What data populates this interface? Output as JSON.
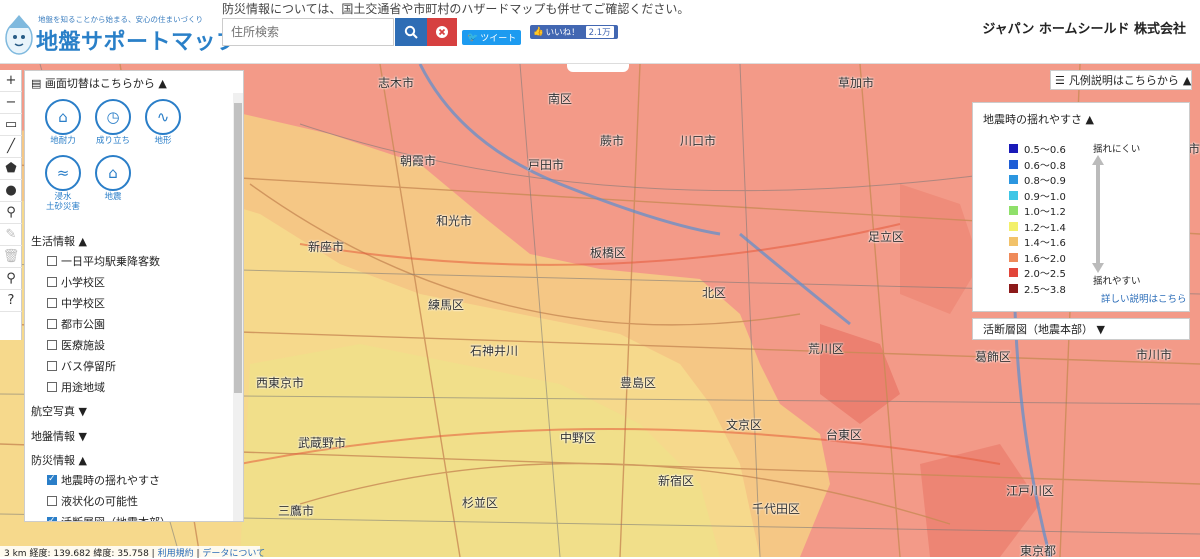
{
  "header": {
    "tagline": "地盤を知ることから始まる、安心の住まいづくり",
    "title": "地盤サポートマップ",
    "notice": "防災情報については、国土交通省や市町村のハザードマップも併せてご確認ください。",
    "search_placeholder": "住所検索",
    "tweet_label": "ツイート",
    "like_label": "いいね！",
    "like_count": "2.1万",
    "company": "ジャパン ホームシールド 株式会社"
  },
  "panel": {
    "title": "画面切替はこちらから",
    "theme_icons": [
      {
        "label": "地耐力",
        "icon": "house-ground-icon"
      },
      {
        "label": "成り立ち",
        "icon": "clock-history-icon"
      },
      {
        "label": "地形",
        "icon": "terrain-icon"
      },
      {
        "label": "浸水\n土砂災害",
        "icon": "flood-icon"
      },
      {
        "label": "地震",
        "icon": "earthquake-icon"
      }
    ],
    "life_section": "生活情報",
    "life_items": [
      "一日平均駅乗降客数",
      "小学校区",
      "中学校区",
      "都市公園",
      "医療施設",
      "バス停留所",
      "用途地域"
    ],
    "aerial_section": "航空写真",
    "ground_section": "地盤情報",
    "disaster_section": "防災情報",
    "disaster_items": [
      {
        "label": "地震時の揺れやすさ",
        "checked": true
      },
      {
        "label": "液状化の可能性",
        "checked": false
      },
      {
        "label": "活断層図（地震本部）",
        "checked": true
      }
    ]
  },
  "legend_toggle": "凡例説明はこちらから",
  "legend": {
    "heading": "地震時の揺れやすさ",
    "rows": [
      {
        "range": "0.5～0.6",
        "color": "#1a1ab8"
      },
      {
        "range": "0.6～0.8",
        "color": "#1f5ed6"
      },
      {
        "range": "0.8～0.9",
        "color": "#2b96e0"
      },
      {
        "range": "0.9～1.0",
        "color": "#3ec6e6"
      },
      {
        "range": "1.0～1.2",
        "color": "#8fe06a"
      },
      {
        "range": "1.2～1.4",
        "color": "#f3f06a"
      },
      {
        "range": "1.4～1.6",
        "color": "#f2c26a"
      },
      {
        "range": "1.6～2.0",
        "color": "#ef8a5a"
      },
      {
        "range": "2.0～2.5",
        "color": "#e2453a"
      },
      {
        "range": "2.5～3.8",
        "color": "#8c1a1a"
      }
    ],
    "hard_label": "揺れにくい",
    "easy_label": "揺れやすい",
    "more_link": "詳しい説明はこちら"
  },
  "fault_panel": "活断層図（地震本部）",
  "scale": {
    "km": "3 km",
    "coords": "経度: 139.682 緯度: 35.758",
    "terms": "利用規約",
    "data": "データについて"
  },
  "places": [
    "志木市",
    "南区",
    "草加市",
    "八潮市",
    "朝霞市",
    "戸田市",
    "川口市",
    "蕨市",
    "新座市",
    "和光市",
    "板橋区",
    "足立区",
    "練馬区",
    "北区",
    "荒川区",
    "葛飾区",
    "西東京市",
    "豊島区",
    "台東区",
    "武蔵野市",
    "中野区",
    "文京区",
    "江戸川区",
    "三鷹市",
    "杉並区",
    "新宿区",
    "千代田区",
    "市川市",
    "東京都",
    "石神井川"
  ]
}
